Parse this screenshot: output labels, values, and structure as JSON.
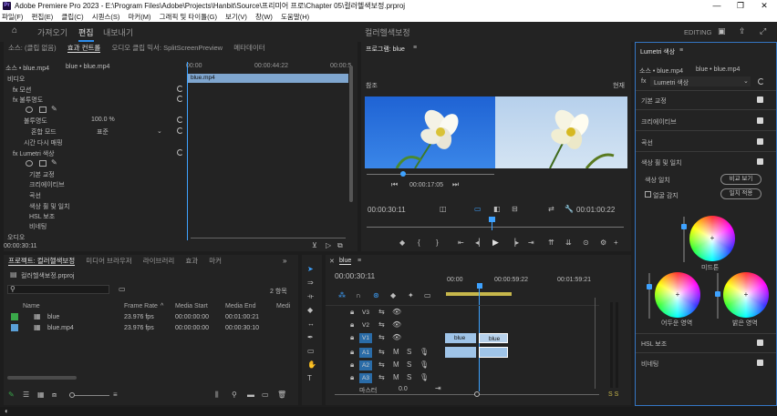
{
  "titlebar": {
    "app": "Adobe Premiere Pro 2023 - E:\\Program Files\\Adobe\\Projects\\Hanbit\\Source\\프리미어 프로\\Chapter 05\\컬러헬색보정.prproj",
    "min": "—",
    "max": "❐",
    "close": "✕"
  },
  "menu": [
    "파일(F)",
    "편집(E)",
    "클립(C)",
    "시퀀스(S)",
    "마커(M)",
    "그래픽 및 타이틀(G)",
    "보기(V)",
    "창(W)",
    "도움말(H)"
  ],
  "workspace": {
    "tabs": [
      "가져오기",
      "편집",
      "내보내기"
    ],
    "center_title": "컬러헬색보정",
    "editing": "EDITING"
  },
  "effect_controls": {
    "tabs": [
      "소스: (클립 없음)",
      "효과 컨트롤",
      "오디오 클립 믹서: SplitScreenPreview",
      "메타데이터"
    ],
    "source": "소스 • blue.mp4",
    "target": "blue • blue.mp4",
    "tc_start": "00:00",
    "tc_mid": "00:00:44:22",
    "tc_end": "00:00:5",
    "clip_name": "blue.mp4",
    "rows": [
      "비디오",
      "모션",
      "불투명도",
      "불투명도",
      "혼합 모드",
      "시간 다시 매핑",
      "Lumetri 색상",
      "기본 교정",
      "크리에이티브",
      "곡선",
      "색상 휠 및 일치",
      "HSL 보조",
      "비네팅",
      "오디오"
    ],
    "fx": "fx",
    "opacity_value": "100.0 %",
    "blend_value": "표준",
    "footer_tc": "00:00:30:11"
  },
  "program": {
    "title": "프로그램: blue",
    "menu": "≡",
    "label_ref": "참조",
    "label_cur": "현재",
    "ref_tc": "00:00:17:05",
    "tc": "00:00:30:11",
    "duration": "00:01:00:22"
  },
  "lumetri": {
    "title": "Lumetri 색상",
    "menu": "≡",
    "source": "소스 • blue.mp4",
    "target": "blue • blue.mp4",
    "fx": "fx",
    "effect": "Lumetri 색상",
    "sections": [
      "기본 교정",
      "크리에이티브",
      "곡선",
      "색상 휠 및 일치",
      "HSL 보조",
      "비네팅"
    ],
    "color_match": "색상 일치",
    "compare": "비교 보기",
    "face": "얼굴 감지",
    "apply": "일치 적용",
    "midtones": "미드톤",
    "shadows": "어두운 영역",
    "highlights": "밝은 영역"
  },
  "project": {
    "tabs": [
      "프로젝트: 컬러헬색보정",
      "미디어 브라우저",
      "라이브러리",
      "효과",
      "마커"
    ],
    "file": "컬러헬색보정.prproj",
    "count": "2 항목",
    "columns": [
      "Name",
      "Frame Rate",
      "Media Start",
      "Media End",
      "Medi"
    ],
    "items": [
      {
        "name": "blue",
        "rate": "23.976 fps",
        "start": "00:00:00:00",
        "end": "00:01:00:21",
        "color": "#3aa94a"
      },
      {
        "name": "blue.mp4",
        "rate": "23.976 fps",
        "start": "00:00:00:00",
        "end": "00:00:30:10",
        "color": "#5aa0d8"
      }
    ],
    "search_placeholder": ""
  },
  "timeline": {
    "tab": "blue",
    "menu": "≡",
    "tc": "00:00:30:11",
    "ruler": [
      "00:00",
      "00:00:59:22",
      "00:01:59:21"
    ],
    "tracks": [
      "V3",
      "V2",
      "V1",
      "A1",
      "A2",
      "A3"
    ],
    "master": "마스터",
    "master_val": "0.0",
    "clip_video1": "blue",
    "clip_video2": "blue",
    "meter": "S S"
  },
  "colors": {
    "accent": "#2d8ceb",
    "v1": "#9fc4e8",
    "a1": "#9fc4e8",
    "ref_sky": "#2e6fd6",
    "cur_sky": "#b9d2ec"
  }
}
